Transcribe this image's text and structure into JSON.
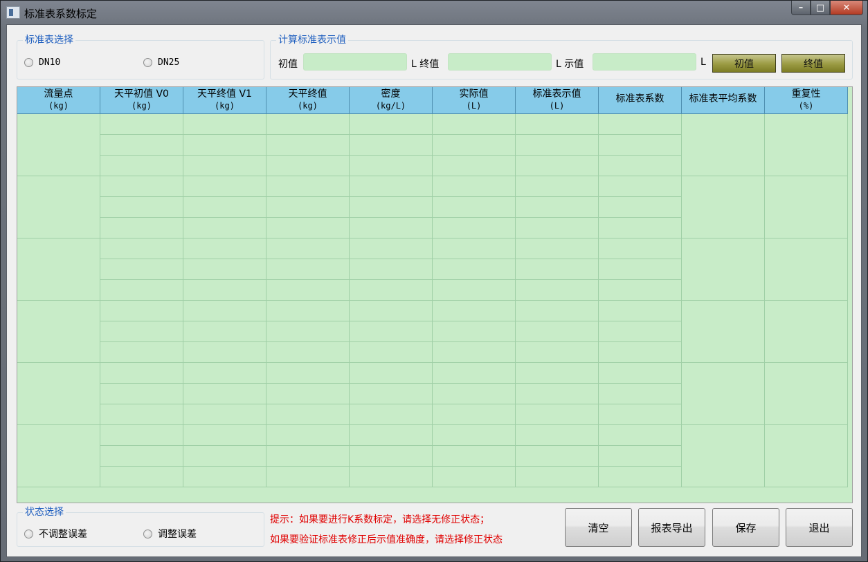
{
  "window": {
    "title": "标准表系数标定",
    "min_icon": "minimize-icon",
    "max_icon": "maximize-icon",
    "close_icon": "close-icon"
  },
  "meter_select": {
    "legend": "标准表选择",
    "options": [
      "DN10",
      "DN25"
    ]
  },
  "calc": {
    "legend": "计算标准表示值",
    "initial_label": "初值",
    "final_label": "L 终值",
    "reading_label": "L 示值",
    "unit_end": "L",
    "initial_value": "",
    "final_value": "",
    "reading_value": "",
    "btn_initial": "初值",
    "btn_final": "终值"
  },
  "table": {
    "headers": [
      {
        "l1": "流量点",
        "l2": "(kg)"
      },
      {
        "l1": "天平初值 V0",
        "l2": "(kg)"
      },
      {
        "l1": "天平终值 V1",
        "l2": "(kg)"
      },
      {
        "l1": "天平终值",
        "l2": "(kg)"
      },
      {
        "l1": "密度",
        "l2": "(kg/L)"
      },
      {
        "l1": "实际值",
        "l2": "(L)"
      },
      {
        "l1": "标准表示值",
        "l2": "(L)"
      },
      {
        "l1": "标准表系数",
        "l2": ""
      },
      {
        "l1": "标准表平均系数",
        "l2": ""
      },
      {
        "l1": "重复性",
        "l2": "(%)"
      }
    ],
    "groups": 6,
    "rows_per_group": 3
  },
  "status_select": {
    "legend": "状态选择",
    "options": [
      "不调整误差",
      "调整误差"
    ]
  },
  "hints": [
    "提示：如果要进行K系数标定，请选择无修正状态；",
    "如果要验证标准表修正后示值准确度，请选择修正状态"
  ],
  "buttons": {
    "clear": "清空",
    "export": "报表导出",
    "save": "保存",
    "exit": "退出"
  },
  "colors": {
    "field_green": "#c8ecc8",
    "header_blue": "#86cbe9",
    "olive_button": "#9b9b43",
    "hint_red": "#e00000",
    "legend_blue": "#1f5fbf"
  }
}
